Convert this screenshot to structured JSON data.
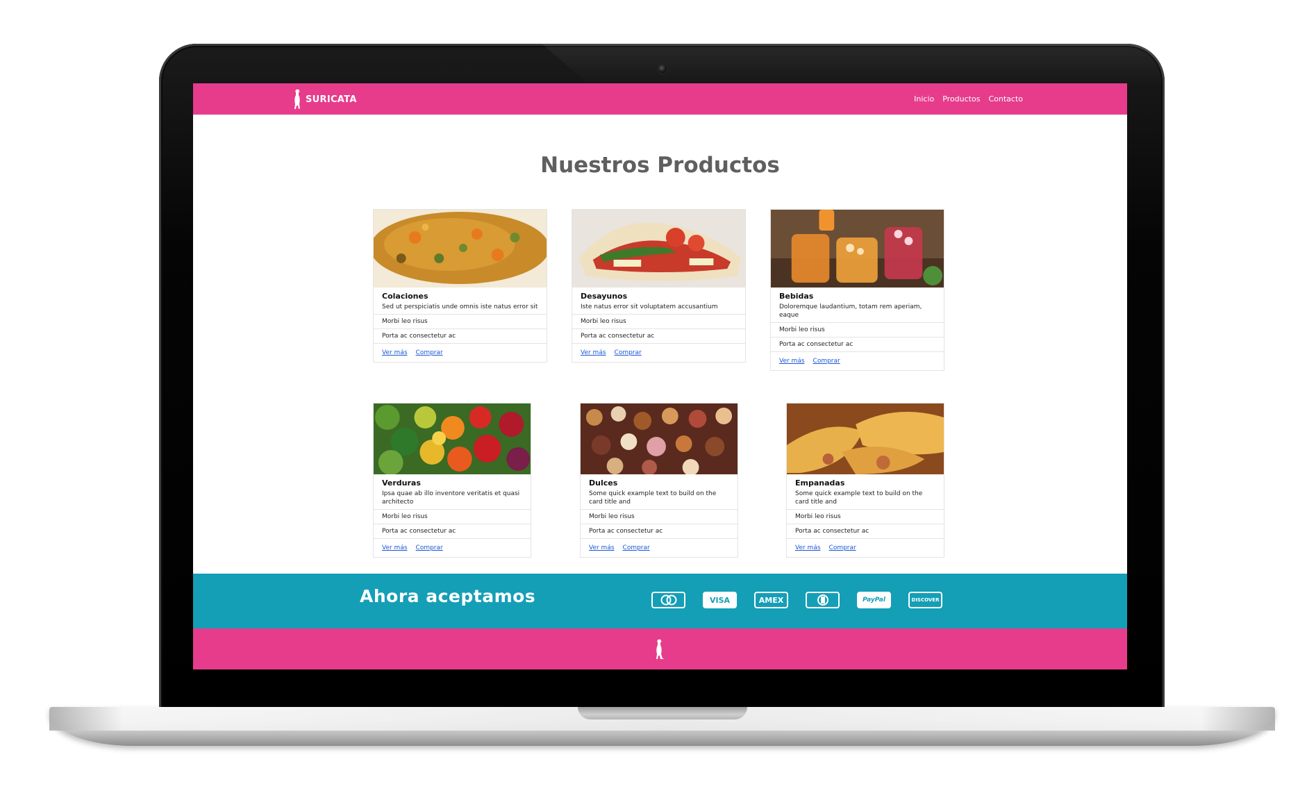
{
  "header": {
    "brand": "SURICATA",
    "nav": [
      "Inicio",
      "Productos",
      "Contacto"
    ]
  },
  "main": {
    "title": "Nuestros Productos",
    "cards": [
      {
        "title": "Colaciones",
        "text": "Sed ut perspiciatis unde omnis iste natus error sit",
        "item1": "Morbi leo risus",
        "item2": "Porta ac consectetur ac",
        "link1": "Ver más",
        "link2": "Comprar"
      },
      {
        "title": "Desayunos",
        "text": "Iste natus error sit voluptatem accusantium",
        "item1": "Morbi leo risus",
        "item2": "Porta ac consectetur ac",
        "link1": "Ver más",
        "link2": "Comprar"
      },
      {
        "title": "Bebidas",
        "text": "Doloremque laudantium, totam rem aperiam, eaque",
        "item1": "Morbi leo risus",
        "item2": "Porta ac consectetur ac",
        "link1": "Ver más",
        "link2": "Comprar"
      },
      {
        "title": "Verduras",
        "text": "Ipsa quae ab illo inventore veritatis et quasi architecto",
        "item1": "Morbi leo risus",
        "item2": "Porta ac consectetur ac",
        "link1": "Ver más",
        "link2": "Comprar"
      },
      {
        "title": "Dulces",
        "text": "Some quick example text to build on the card title and",
        "item1": "Morbi leo risus",
        "item2": "Porta ac consectetur ac",
        "link1": "Ver más",
        "link2": "Comprar"
      },
      {
        "title": "Empanadas",
        "text": "Some quick example text to build on the card title and",
        "item1": "Morbi leo risus",
        "item2": "Porta ac consectetur ac",
        "link1": "Ver más",
        "link2": "Comprar"
      }
    ]
  },
  "payments": {
    "title": "Ahora aceptamos",
    "methods": [
      "mastercard",
      "VISA",
      "AMEX",
      "Diners Club",
      "PayPal",
      "DISCOVER"
    ]
  },
  "colors": {
    "brand_pink": "#e63c8b",
    "teal": "#149fb7",
    "title_gray": "#5f5f5f",
    "link_blue": "#1a57d6"
  },
  "icons": [
    "meerkat-logo-icon",
    "mastercard-icon",
    "visa-icon",
    "amex-icon",
    "diners-icon",
    "paypal-icon",
    "discover-icon",
    "webcam-icon"
  ]
}
